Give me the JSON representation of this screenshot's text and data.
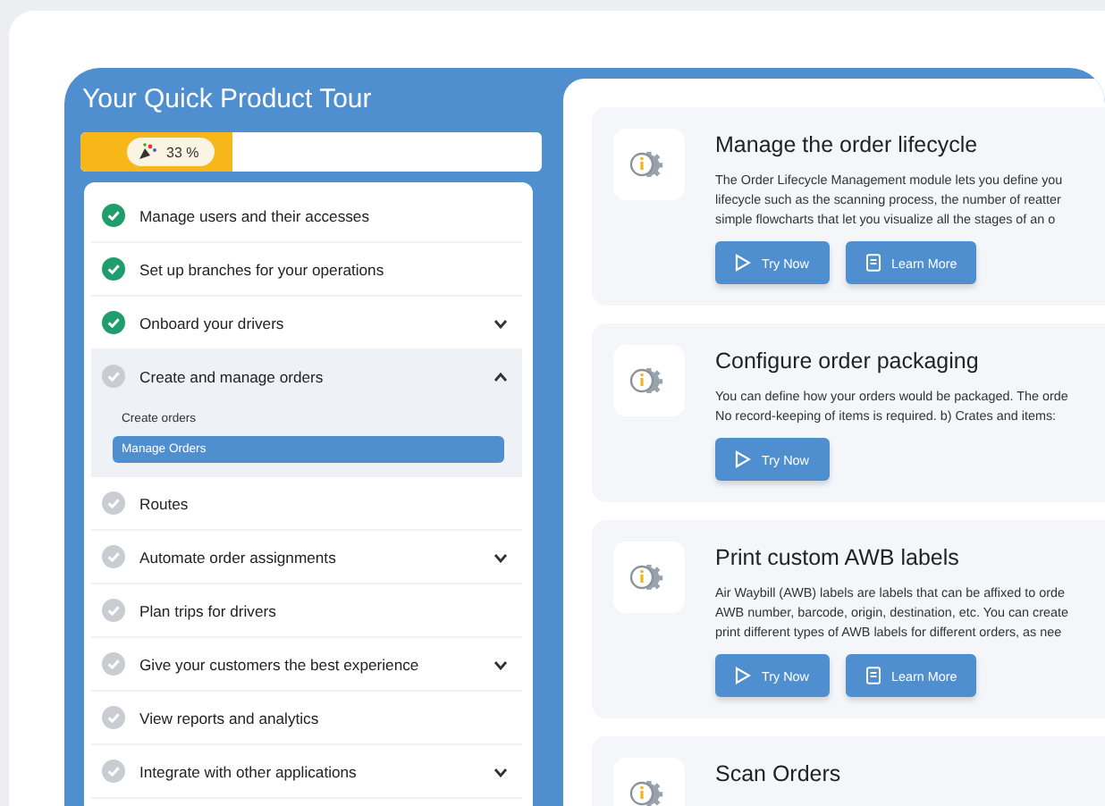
{
  "tour": {
    "title": "Your Quick Product Tour",
    "progress": {
      "level": 0.33,
      "label": "33 %"
    },
    "steps": [
      {
        "label": "Manage users and their accesses",
        "done": true,
        "expandable": false,
        "expanded": false
      },
      {
        "label": "Set up branches for your operations",
        "done": true,
        "expandable": false,
        "expanded": false
      },
      {
        "label": "Onboard your drivers",
        "done": true,
        "expandable": true,
        "expanded": false
      },
      {
        "label": "Create and manage orders",
        "done": false,
        "expandable": true,
        "expanded": true,
        "children": [
          {
            "label": "Create orders",
            "selected": false
          },
          {
            "label": "Manage Orders",
            "selected": true
          }
        ]
      },
      {
        "label": "Routes",
        "done": false,
        "expandable": false,
        "expanded": false
      },
      {
        "label": "Automate order assignments",
        "done": false,
        "expandable": true,
        "expanded": false
      },
      {
        "label": "Plan trips for drivers",
        "done": false,
        "expandable": false,
        "expanded": false
      },
      {
        "label": "Give your customers the best experience",
        "done": false,
        "expandable": true,
        "expanded": false
      },
      {
        "label": "View reports and analytics",
        "done": false,
        "expandable": false,
        "expanded": false
      },
      {
        "label": "Integrate with other applications",
        "done": false,
        "expandable": true,
        "expanded": false
      }
    ]
  },
  "cards": [
    {
      "title": "Manage the order lifecycle",
      "lines": [
        "The Order Lifecycle Management module lets you define you",
        "lifecycle such as the scanning process, the number of reatter",
        "simple flowcharts that let you visualize all the stages of an o"
      ],
      "buttons": [
        {
          "kind": "try",
          "label": "Try Now"
        },
        {
          "kind": "learn",
          "label": "Learn More"
        }
      ]
    },
    {
      "title": "Configure order packaging",
      "lines": [
        "You can define how your orders would be packaged. The orde",
        "No record-keeping of items is required. b) Crates and items:"
      ],
      "buttons": [
        {
          "kind": "try",
          "label": "Try Now"
        }
      ]
    },
    {
      "title": "Print custom AWB labels",
      "lines": [
        "Air Waybill (AWB) labels are labels that can be affixed to orde",
        "AWB number, barcode, origin, destination, etc. You can create",
        "print different types of AWB labels for different orders, as nee"
      ],
      "buttons": [
        {
          "kind": "try",
          "label": "Try Now"
        },
        {
          "kind": "learn",
          "label": "Learn More"
        }
      ]
    },
    {
      "title": "Scan Orders"
    }
  ]
}
